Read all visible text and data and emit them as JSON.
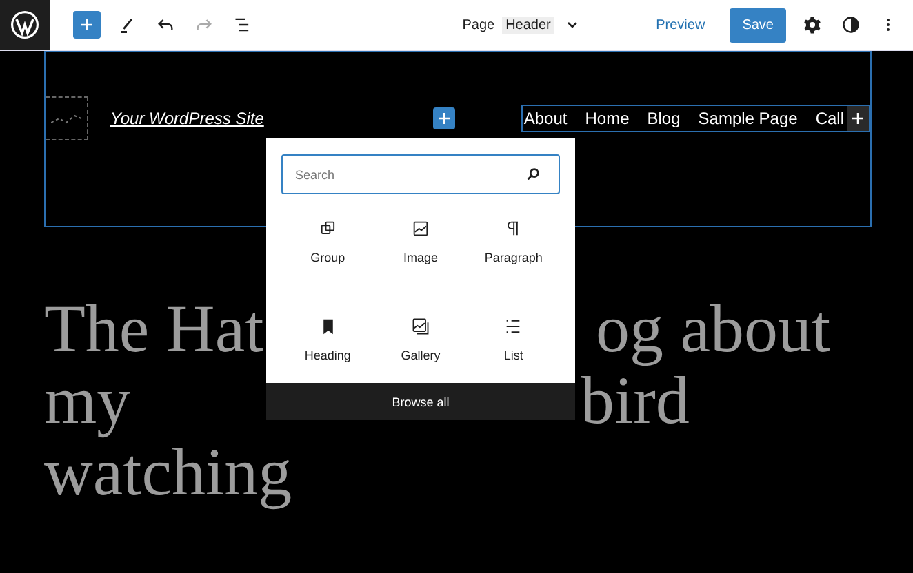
{
  "toolbar": {
    "page_label": "Page",
    "template": "Header",
    "preview": "Preview",
    "save": "Save"
  },
  "header": {
    "site_title": "Your WordPress Site",
    "nav": [
      "About",
      "Home",
      "Blog",
      "Sample Page",
      "Call"
    ]
  },
  "heading": {
    "line_1_start": "The Hat",
    "line_1_end": "og about",
    "line_2_start": "my",
    "line_2_end": "bird",
    "line_3": "watching"
  },
  "inserter": {
    "placeholder": "Search",
    "blocks": [
      {
        "kind": "group",
        "label": "Group"
      },
      {
        "kind": "image",
        "label": "Image"
      },
      {
        "kind": "paragraph",
        "label": "Paragraph"
      },
      {
        "kind": "heading",
        "label": "Heading"
      },
      {
        "kind": "gallery",
        "label": "Gallery"
      },
      {
        "kind": "list",
        "label": "List"
      }
    ],
    "browse_all": "Browse all"
  }
}
